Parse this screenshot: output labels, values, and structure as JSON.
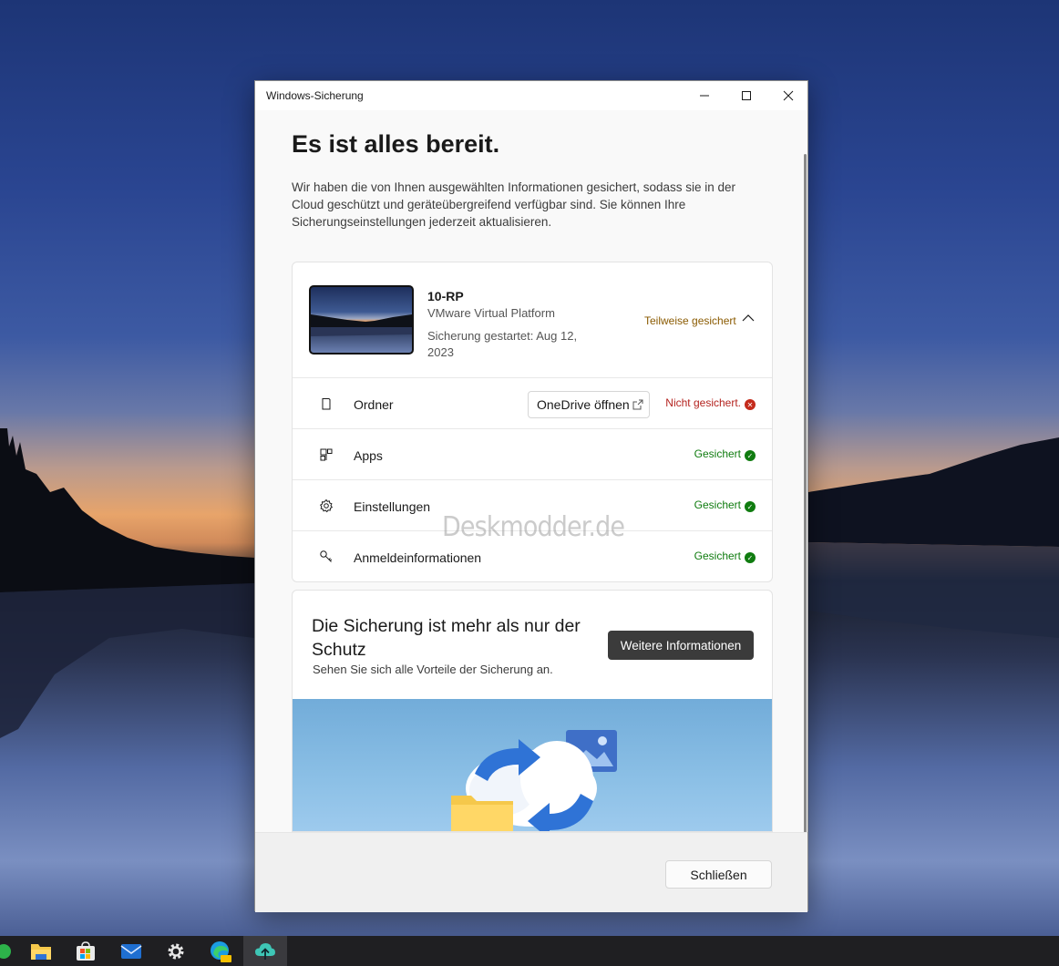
{
  "window": {
    "title": "Windows-Sicherung",
    "controls": {
      "minimize_icon": "minimize-icon",
      "maximize_icon": "maximize-icon",
      "close_icon": "close-icon"
    }
  },
  "main": {
    "heading": "Es ist alles bereit.",
    "intro": "Wir haben die von Ihnen ausgewählten Informationen gesichert, sodass sie in der Cloud geschützt und geräteübergreifend verfügbar sind. Sie können Ihre Sicherungseinstellungen jederzeit aktualisieren."
  },
  "device": {
    "name": "10-RP",
    "type": "VMware Virtual Platform",
    "started": "Sicherung gestartet: Aug 12, 2023",
    "status": "Teilweise gesichert",
    "status_color": "#8a5a00"
  },
  "backup_items": [
    {
      "label": "Ordner",
      "icon": "folder-icon",
      "status": "Nicht gesichert.",
      "state": "error",
      "button": "OneDrive öffnen"
    },
    {
      "label": "Apps",
      "icon": "apps-icon",
      "status": "Gesichert",
      "state": "ok"
    },
    {
      "label": "Einstellungen",
      "icon": "gear-icon",
      "status": "Gesichert",
      "state": "ok"
    },
    {
      "label": "Anmeldeinformationen",
      "icon": "key-icon",
      "status": "Gesichert",
      "state": "ok"
    }
  ],
  "colors": {
    "ok": "#107c10",
    "error": "#c42b1c",
    "accent_dark_button": "#3b3b3b"
  },
  "promo": {
    "title": "Die Sicherung ist mehr als nur der Schutz",
    "subtitle": "Sehen Sie sich alle Vorteile der Sicherung an.",
    "button": "Weitere Informationen"
  },
  "footer": {
    "close_button": "Schließen"
  },
  "watermark": "Deskmodder.de",
  "taskbar": {
    "apps": [
      "file-explorer-icon",
      "store-icon",
      "mail-icon",
      "settings-icon",
      "edge-canary-icon",
      "backup-icon"
    ]
  }
}
